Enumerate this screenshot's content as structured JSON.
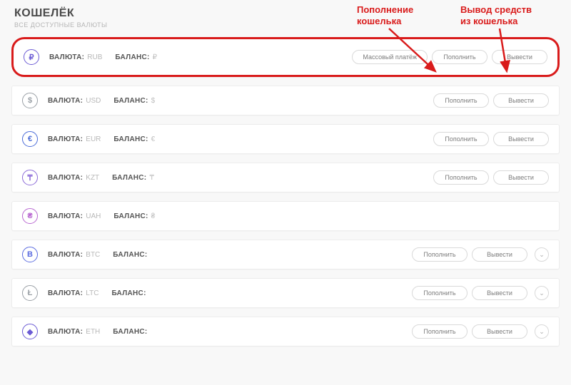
{
  "header": {
    "title": "КОШЕЛЁК",
    "subtitle": "ВСЕ ДОСТУПНЫЕ ВАЛЮТЫ"
  },
  "labels": {
    "currency": "ВАЛЮТА:",
    "balance": "БАЛАНС:"
  },
  "buttons": {
    "mass": "Массовый платёж",
    "deposit": "Пополнить",
    "withdraw": "Вывести"
  },
  "annotations": {
    "deposit": "Пополнение кошелька",
    "withdraw": "Вывод средств из кошелька"
  },
  "currencies": [
    {
      "code": "RUB",
      "symbol": "₽",
      "glyph": "₽",
      "color": "#6b5bd4",
      "highlight": true,
      "mass": true,
      "deposit": true,
      "withdraw": true,
      "expand": false
    },
    {
      "code": "USD",
      "symbol": "$",
      "glyph": "$",
      "color": "#9aa0a6",
      "highlight": false,
      "mass": false,
      "deposit": true,
      "withdraw": true,
      "expand": false
    },
    {
      "code": "EUR",
      "symbol": "€",
      "glyph": "€",
      "color": "#4a6bd8",
      "highlight": false,
      "mass": false,
      "deposit": true,
      "withdraw": true,
      "expand": false
    },
    {
      "code": "KZT",
      "symbol": "₸",
      "glyph": "₸",
      "color": "#8c6bd8",
      "highlight": false,
      "mass": false,
      "deposit": true,
      "withdraw": true,
      "expand": false
    },
    {
      "code": "UAH",
      "symbol": "₴",
      "glyph": "₴",
      "color": "#b867d1",
      "highlight": false,
      "mass": false,
      "deposit": false,
      "withdraw": false,
      "expand": false
    },
    {
      "code": "BTC",
      "symbol": "",
      "glyph": "B",
      "color": "#5a6be0",
      "highlight": false,
      "mass": false,
      "deposit": true,
      "withdraw": true,
      "expand": true
    },
    {
      "code": "LTC",
      "symbol": "",
      "glyph": "Ł",
      "color": "#9aa0a6",
      "highlight": false,
      "mass": false,
      "deposit": true,
      "withdraw": true,
      "expand": true
    },
    {
      "code": "ETH",
      "symbol": "",
      "glyph": "◆",
      "color": "#6b5bd4",
      "highlight": false,
      "mass": false,
      "deposit": true,
      "withdraw": true,
      "expand": true
    }
  ]
}
